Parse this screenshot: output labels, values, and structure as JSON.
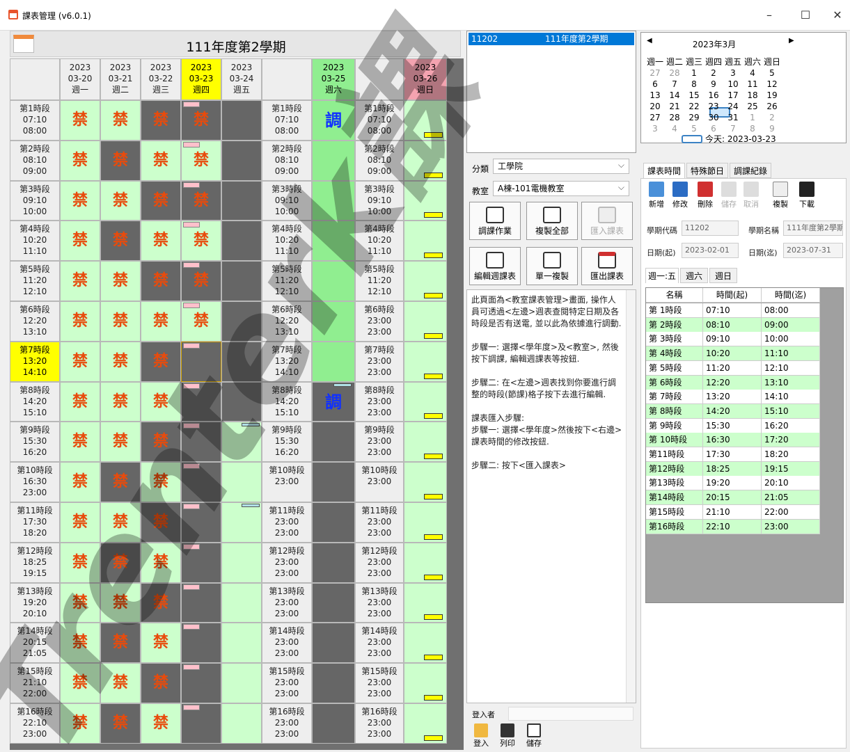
{
  "window": {
    "title": "課表管理 (v6.0.1)",
    "minimize": "–",
    "maximize": "☐",
    "close": "✕"
  },
  "left": {
    "semester_title": "111年度第2學期",
    "day_headers": [
      {
        "year": "2023",
        "date": "03-20",
        "wd": "週一"
      },
      {
        "year": "2023",
        "date": "03-21",
        "wd": "週二"
      },
      {
        "year": "2023",
        "date": "03-22",
        "wd": "週三"
      },
      {
        "year": "2023",
        "date": "03-23",
        "wd": "週四"
      },
      {
        "year": "2023",
        "date": "03-24",
        "wd": "週五"
      },
      {
        "year": "2023",
        "date": "03-25",
        "wd": "週六"
      },
      {
        "year": "2023",
        "date": "03-26",
        "wd": "週日"
      }
    ],
    "periods": [
      {
        "name": "第1時段",
        "s": "07:10",
        "e": "08:00"
      },
      {
        "name": "第2時段",
        "s": "08:10",
        "e": "09:00"
      },
      {
        "name": "第3時段",
        "s": "09:10",
        "e": "10:00"
      },
      {
        "name": "第4時段",
        "s": "10:20",
        "e": "11:10"
      },
      {
        "name": "第5時段",
        "s": "11:20",
        "e": "12:10"
      },
      {
        "name": "第6時段",
        "s": "12:20",
        "e": "13:10"
      },
      {
        "name": "第7時段",
        "s": "13:20",
        "e": "14:10"
      },
      {
        "name": "第8時段",
        "s": "14:20",
        "e": "15:10"
      },
      {
        "name": "第9時段",
        "s": "15:30",
        "e": "16:20"
      },
      {
        "name": "第10時段",
        "s": "16:30",
        "e": "23:00"
      },
      {
        "name": "第11時段",
        "s": "17:30",
        "e": "18:20"
      },
      {
        "name": "第12時段",
        "s": "18:25",
        "e": "19:15"
      },
      {
        "name": "第13時段",
        "s": "19:20",
        "e": "20:10"
      },
      {
        "name": "第14時段",
        "s": "20:15",
        "e": "21:05"
      },
      {
        "name": "第15時段",
        "s": "21:10",
        "e": "22:00"
      },
      {
        "name": "第16時段",
        "s": "22:10",
        "e": "23:00"
      }
    ],
    "ban": "禁",
    "adjust": "調",
    "sat_rows": [
      {
        "name": "第1時段",
        "s": "07:10",
        "e": "08:00"
      },
      {
        "name": "第2時段",
        "s": "08:10",
        "e": "09:00"
      },
      {
        "name": "第3時段",
        "s": "09:10",
        "e": "10:00"
      },
      {
        "name": "第4時段",
        "s": "10:20",
        "e": "11:10"
      },
      {
        "name": "第5時段",
        "s": "11:20",
        "e": "12:10"
      },
      {
        "name": "第6時段",
        "s": "12:20",
        "e": "13:10"
      },
      {
        "name": "第7時段",
        "s": "13:20",
        "e": "14:10"
      },
      {
        "name": "第8時段",
        "s": "14:20",
        "e": "15:10"
      },
      {
        "name": "第9時段",
        "s": "15:30",
        "e": "16:20"
      },
      {
        "name": "第10時段",
        "s": "23:00",
        "e": ""
      },
      {
        "name": "第11時段",
        "s": "23:00",
        "e": "23:00"
      },
      {
        "name": "第12時段",
        "s": "23:00",
        "e": "23:00"
      },
      {
        "name": "第13時段",
        "s": "23:00",
        "e": "23:00"
      },
      {
        "name": "第14時段",
        "s": "23:00",
        "e": "23:00"
      },
      {
        "name": "第15時段",
        "s": "23:00",
        "e": "23:00"
      },
      {
        "name": "第16時段",
        "s": "23:00",
        "e": "23:00"
      }
    ],
    "sun_rows": [
      {
        "name": "第1時段",
        "s": "07:10",
        "e": "08:00"
      },
      {
        "name": "第2時段",
        "s": "08:10",
        "e": "09:00"
      },
      {
        "name": "第3時段",
        "s": "09:10",
        "e": "10:00"
      },
      {
        "name": "第4時段",
        "s": "10:20",
        "e": "11:10"
      },
      {
        "name": "第5時段",
        "s": "11:20",
        "e": "12:10"
      },
      {
        "name": "第6時段",
        "s": "23:00",
        "e": "23:00"
      },
      {
        "name": "第7時段",
        "s": "23:00",
        "e": "23:00"
      },
      {
        "name": "第8時段",
        "s": "23:00",
        "e": "23:00"
      },
      {
        "name": "第9時段",
        "s": "23:00",
        "e": "23:00"
      },
      {
        "name": "第10時段",
        "s": "23:00",
        "e": ""
      },
      {
        "name": "第11時段",
        "s": "23:00",
        "e": "23:00"
      },
      {
        "name": "第12時段",
        "s": "23:00",
        "e": "23:00"
      },
      {
        "name": "第13時段",
        "s": "23:00",
        "e": "23:00"
      },
      {
        "name": "第14時段",
        "s": "23:00",
        "e": "23:00"
      },
      {
        "name": "第15時段",
        "s": "23:00",
        "e": "23:00"
      },
      {
        "name": "第16時段",
        "s": "23:00",
        "e": "23:00"
      }
    ]
  },
  "middle": {
    "semester_code": "11202",
    "semester_name": "111年度第2學期",
    "category_label": "分類",
    "category_value": "工學院",
    "classroom_label": "教室",
    "classroom_value": "A棟-101電機教室",
    "btn_adjust": "調課作業",
    "btn_copy_all": "複製全部",
    "btn_import": "匯入課表",
    "btn_edit_week": "編輯週課表",
    "btn_copy_one": "單一複製",
    "btn_export": "匯出課表",
    "help": [
      "此頁面為<教室課表管理>畫面, 操作人員可透過<左邊>週表查閱特定日期及各時段是否有送電, 並以此為依據進行調動.",
      "步驟一: 選擇<學年度>及<教室>, 然後按下調課, 編輯週課表等按鈕.",
      "步驟二: 在<左邊>週表找到你要進行調整的時段(節課)格子按下去進行編輯.",
      "課表匯入步驟:\n步驟一: 選擇<學年度>然後按下<右邊>課表時間的修改按鈕.",
      "步驟二: 按下<匯入課表>"
    ],
    "login_label": "登入者",
    "btn_login": "登入",
    "btn_print": "列印",
    "btn_save": "儲存"
  },
  "right": {
    "cal_title": "2023年3月",
    "cal_weekdays": [
      "週一",
      "週二",
      "週三",
      "週四",
      "週五",
      "週六",
      "週日"
    ],
    "cal_rows": [
      [
        "27",
        "28",
        "1",
        "2",
        "3",
        "4",
        "5"
      ],
      [
        "6",
        "7",
        "8",
        "9",
        "10",
        "11",
        "12"
      ],
      [
        "13",
        "14",
        "15",
        "16",
        "17",
        "18",
        "19"
      ],
      [
        "20",
        "21",
        "22",
        "23",
        "24",
        "25",
        "26"
      ],
      [
        "27",
        "28",
        "29",
        "30",
        "31",
        "1",
        "2"
      ],
      [
        "3",
        "4",
        "5",
        "6",
        "7",
        "8",
        "9"
      ]
    ],
    "today": "今天: 2023-03-23",
    "tabs": [
      "課表時間",
      "特殊節日",
      "調課紀錄"
    ],
    "tools": [
      "新增",
      "修改",
      "刪除",
      "儲存",
      "取消",
      "複製",
      "下載"
    ],
    "code_label": "學期代碼",
    "code_value": "11202",
    "name_label": "學期名稱",
    "name_value": "111年度第2學期",
    "start_label": "日期(起)",
    "start_value": "2023-02-01",
    "end_label": "日期(迄)",
    "end_value": "2023-07-31",
    "subtabs": [
      "週一:五",
      "週六",
      "週日"
    ],
    "cols": [
      "名稱",
      "時間(起)",
      "時間(迄)"
    ],
    "rows": [
      [
        "第 1時段",
        "07:10",
        "08:00"
      ],
      [
        "第 2時段",
        "08:10",
        "09:00"
      ],
      [
        "第 3時段",
        "09:10",
        "10:00"
      ],
      [
        "第 4時段",
        "10:20",
        "11:10"
      ],
      [
        "第 5時段",
        "11:20",
        "12:10"
      ],
      [
        "第 6時段",
        "12:20",
        "13:10"
      ],
      [
        "第 7時段",
        "13:20",
        "14:10"
      ],
      [
        "第 8時段",
        "14:20",
        "15:10"
      ],
      [
        "第 9時段",
        "15:30",
        "16:20"
      ],
      [
        "第 10時段",
        "16:30",
        "17:20"
      ],
      [
        "第11時段",
        "17:30",
        "18:20"
      ],
      [
        "第12時段",
        "18:25",
        "19:15"
      ],
      [
        "第13時段",
        "19:20",
        "20:10"
      ],
      [
        "第14時段",
        "20:15",
        "21:05"
      ],
      [
        "第15時段",
        "21:10",
        "22:00"
      ],
      [
        "第16時段",
        "22:10",
        "23:00"
      ]
    ]
  },
  "watermark": "Trenterk課"
}
